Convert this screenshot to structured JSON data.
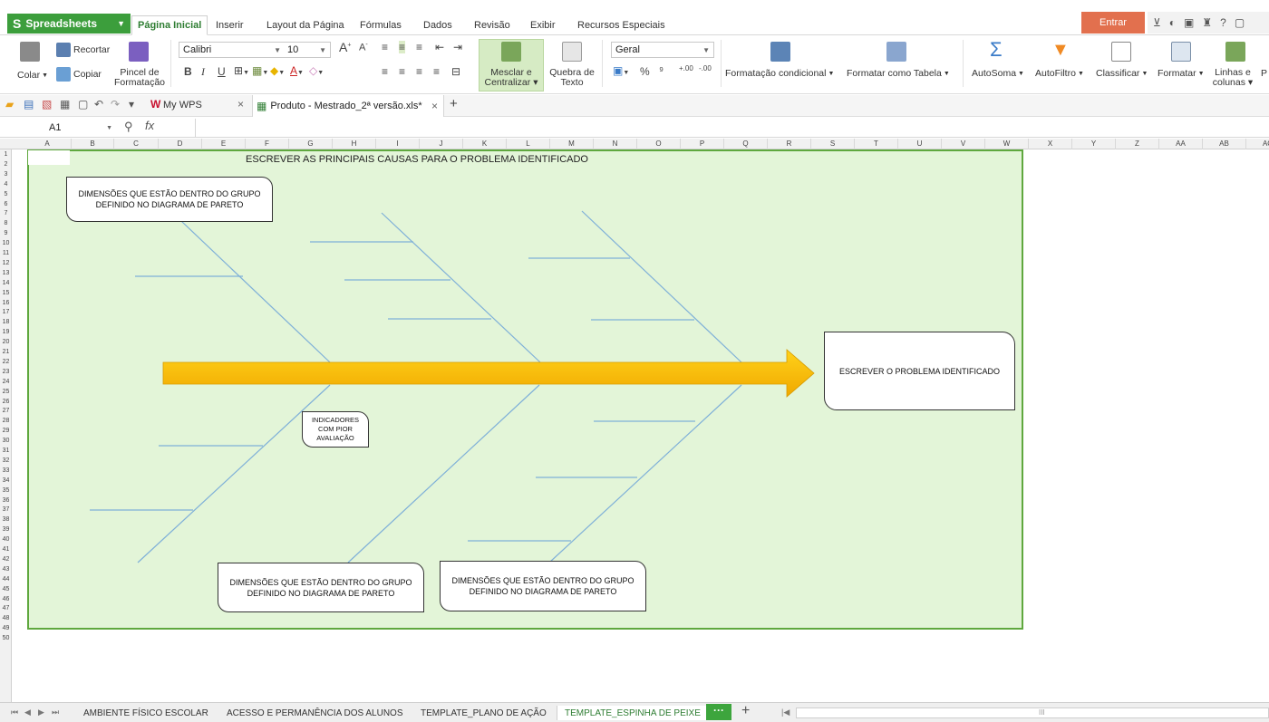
{
  "app": {
    "name": "Spreadsheets",
    "menu_tabs": [
      "Página Inicial",
      "Inserir",
      "Layout da Página",
      "Fórmulas",
      "Dados",
      "Revisão",
      "Exibir",
      "Recursos Especiais"
    ],
    "login_label": "Entrar",
    "help_label": "?"
  },
  "ribbon": {
    "recortar": "Recortar",
    "colar": "Colar",
    "copiar": "Copiar",
    "pincel_line1": "Pincel de",
    "pincel_line2": "Formatação",
    "font_name": "Calibri",
    "font_size": "10",
    "mesclar_line1": "Mesclar e",
    "mesclar_line2": "Centralizar",
    "quebra_line1": "Quebra de",
    "quebra_line2": "Texto",
    "number_format": "Geral",
    "percent": "%",
    "thousands": "⁹",
    "formatacao_condicional": "Formatação condicional",
    "formatar_tabela": "Formatar como Tabela",
    "autosoma": "AutoSoma",
    "autofiltro": "AutoFiltro",
    "classificar": "Classificar",
    "formatar": "Formatar",
    "linhas_line1": "Linhas e",
    "linhas_line2": "colunas",
    "bold": "B",
    "italic": "I",
    "underline": "U",
    "font_color": "A",
    "grow_font": "A",
    "shrink_font": "A",
    "decimal_inc": ".00",
    "decimal_dec": ".00",
    "cut_peek": "P"
  },
  "tabs": {
    "mywps": "My WPS",
    "document": "Produto - Mestrado_2ª versão.xls*"
  },
  "formula_bar": {
    "cell_ref": "A1",
    "fx": "fx"
  },
  "columns": [
    "A",
    "B",
    "C",
    "D",
    "E",
    "F",
    "G",
    "H",
    "I",
    "J",
    "K",
    "L",
    "M",
    "N",
    "O",
    "P",
    "Q",
    "R",
    "S",
    "T",
    "U",
    "V",
    "W",
    "X",
    "Y",
    "Z",
    "AA",
    "AB",
    "AC"
  ],
  "rows": [
    "1",
    "2",
    "3",
    "4",
    "5",
    "6",
    "7",
    "8",
    "9",
    "10",
    "11",
    "12",
    "13",
    "14",
    "15",
    "16",
    "17",
    "18",
    "19",
    "20",
    "21",
    "22",
    "23",
    "24",
    "25",
    "26",
    "27",
    "28",
    "29",
    "30",
    "31",
    "32",
    "33",
    "34",
    "35",
    "36",
    "37",
    "38",
    "39",
    "40",
    "41",
    "42",
    "43",
    "44",
    "45",
    "46",
    "47",
    "48",
    "49",
    "50"
  ],
  "diagram": {
    "title": "ESCREVER AS PRINCIPAIS CAUSAS PARA O PROBLEMA IDENTIFICADO",
    "box_top": "DIMENSÕES QUE ESTÃO DENTRO DO GRUPO DEFINIDO NO DIAGRAMA DE PARETO",
    "box_middle": "INDICADORES COM PIOR AVALIAÇÃO",
    "box_bottom_left": "DIMENSÕES QUE ESTÃO DENTRO DO GRUPO DEFINIDO NO DIAGRAMA DE PARETO",
    "box_bottom_right": "DIMENSÕES QUE ESTÃO DENTRO DO GRUPO DEFINIDO NO DIAGRAMA DE PARETO",
    "problem": "ESCREVER O PROBLEMA IDENTIFICADO",
    "colors": {
      "background": "#e3f5d8",
      "border": "#5fa83e",
      "bones": "#7fb0d8",
      "arrow": "#f5b800"
    }
  },
  "sheets": {
    "tabs": [
      "AMBIENTE FÍSICO ESCOLAR",
      "ACESSO E PERMANÊNCIA DOS ALUNOS",
      "TEMPLATE_PLANO DE AÇÃO",
      "TEMPLATE_ESPINHA DE PEIXE"
    ],
    "active": "TEMPLATE_ESPINHA DE PEIXE",
    "more": "···",
    "add": "+",
    "scroll_mark": "III"
  }
}
